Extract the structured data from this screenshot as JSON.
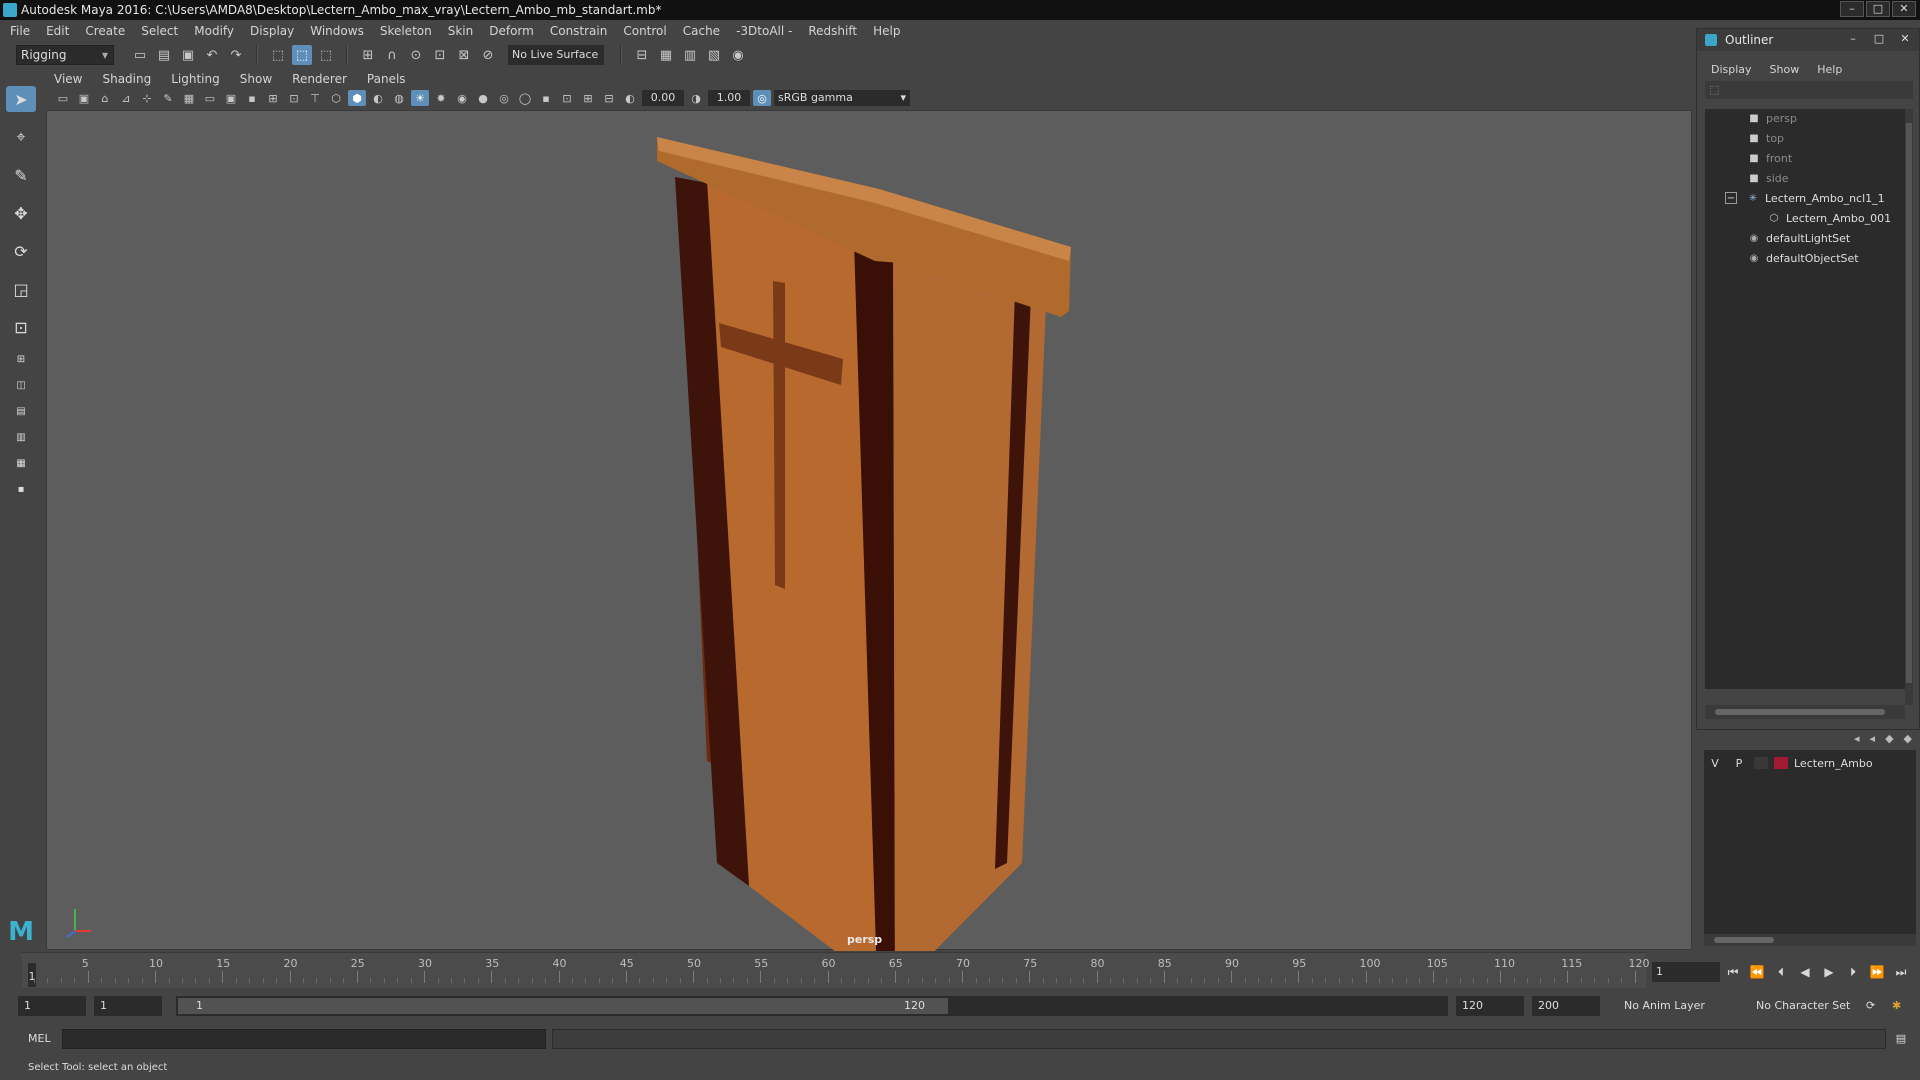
{
  "window": {
    "title": "Autodesk Maya 2016: C:\\Users\\AMDA8\\Desktop\\Lectern_Ambo_max_vray\\Lectern_Ambo_mb_standart.mb*",
    "minimize": "–",
    "maximize": "□",
    "close": "✕"
  },
  "menubar": [
    "File",
    "Edit",
    "Create",
    "Select",
    "Modify",
    "Display",
    "Windows",
    "Skeleton",
    "Skin",
    "Deform",
    "Constrain",
    "Control",
    "Cache",
    "-3DtoAll -",
    "Redshift",
    "Help"
  ],
  "shelf": {
    "mode": "Rigging",
    "live_surface": "No Live Surface"
  },
  "panel_menu": [
    "View",
    "Shading",
    "Lighting",
    "Show",
    "Renderer",
    "Panels"
  ],
  "panel_toolbar": {
    "exposure": "0.00",
    "gamma": "1.00",
    "color_space": "sRGB gamma"
  },
  "viewport": {
    "camera": "persp",
    "axis": {
      "x": "x",
      "y": "y",
      "z": "z"
    }
  },
  "timeline": {
    "ticks": [
      "5",
      "10",
      "15",
      "20",
      "25",
      "30",
      "35",
      "40",
      "45",
      "50",
      "55",
      "60",
      "65",
      "70",
      "75",
      "80",
      "85",
      "90",
      "95",
      "100",
      "105",
      "110",
      "115",
      "120"
    ],
    "playhead": "1",
    "current_frame": "1"
  },
  "range": {
    "start": "1",
    "start_inner": "1",
    "slider_start": "1",
    "slider_end": "120",
    "end_inner": "120",
    "end": "200",
    "anim_layer": "No Anim Layer",
    "character_set": "No Character Set"
  },
  "command_line": {
    "label": "MEL"
  },
  "status": {
    "help": "Select Tool: select an object"
  },
  "outliner": {
    "title": "Outliner",
    "menu": [
      "Display",
      "Show",
      "Help"
    ],
    "items": [
      {
        "label": "persp",
        "icon": "camera-icon"
      },
      {
        "label": "top",
        "icon": "camera-icon"
      },
      {
        "label": "front",
        "icon": "camera-icon"
      },
      {
        "label": "side",
        "icon": "camera-icon"
      },
      {
        "label": "Lectern_Ambo_ncl1_1",
        "icon": "group-icon",
        "expander": "−"
      },
      {
        "label": "Lectern_Ambo_001",
        "icon": "mesh-icon"
      },
      {
        "label": "defaultLightSet",
        "icon": "set-icon"
      },
      {
        "label": "defaultObjectSet",
        "icon": "set-icon"
      }
    ]
  },
  "layers": {
    "v": "V",
    "p": "P",
    "name": "Lectern_Ambo",
    "color": "#a01a33"
  },
  "colors": {
    "accent": "#5d8fb8",
    "viewport_bg": "#5d5d5d",
    "wood": "#b0642a",
    "wood_dark": "#4a1a0a"
  }
}
